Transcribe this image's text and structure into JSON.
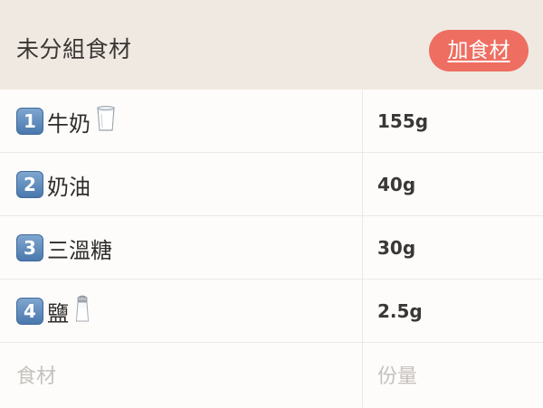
{
  "header": {
    "title": "未分組食材",
    "add_label": "加食材"
  },
  "rows": [
    {
      "number": "1",
      "name": "牛奶",
      "icon": "milk-glass-icon",
      "quantity": "155g"
    },
    {
      "number": "2",
      "name": "奶油",
      "icon": "",
      "quantity": "40g"
    },
    {
      "number": "3",
      "name": "三溫糖",
      "icon": "",
      "quantity": "30g"
    },
    {
      "number": "4",
      "name": "鹽",
      "icon": "salt-shaker-icon",
      "quantity": "2.5g"
    }
  ],
  "new_row": {
    "name_placeholder": "食材",
    "quantity_placeholder": "份量"
  },
  "colors": {
    "header_bg": "#f0e9e2",
    "accent": "#ee6e61",
    "badge": "#5a86ba"
  }
}
